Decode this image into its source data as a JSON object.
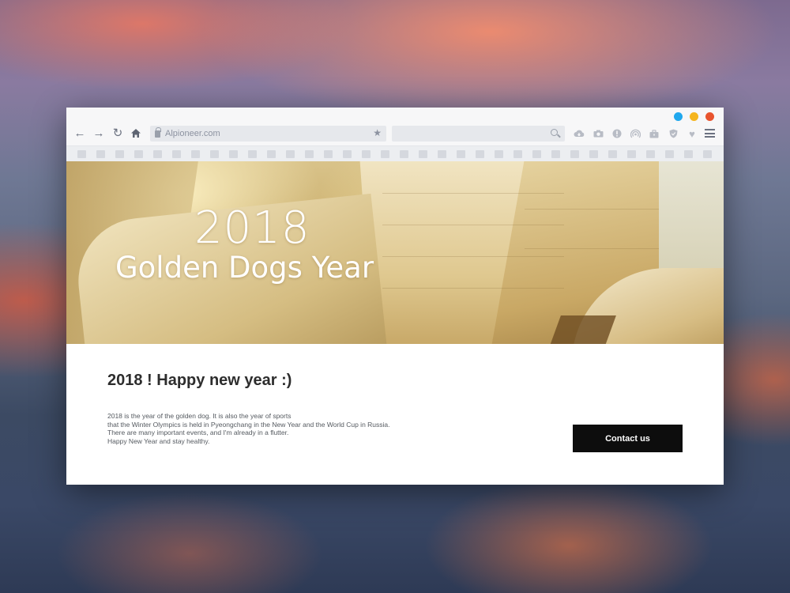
{
  "browser": {
    "window_controls": {
      "blue": "#20a8ee",
      "yellow": "#f5b51e",
      "red": "#e8542e"
    },
    "nav_icons": {
      "back": "←",
      "forward": "→",
      "reload": "↻",
      "home": "⌂"
    },
    "url": "Alpioneer.com",
    "bookmark_star": "★",
    "toolbar_icons": [
      "cloud-download-icon",
      "camera-icon",
      "info-icon",
      "broadcast-icon",
      "briefcase-icon",
      "shield-icon",
      "heart-icon"
    ],
    "toolbar_glyphs": {
      "heart": "♥",
      "info": "!"
    }
  },
  "hero": {
    "year": "2018",
    "subtitle": "Golden Dogs Year"
  },
  "content": {
    "heading": "2018 !  Happy new year :)",
    "body_lines": [
      "2018 is the year of the golden dog. It is also the year of sports",
      "that the Winter Olympics is held in Pyeongchang in the New Year and the World Cup in Russia.",
      "There are many important events,  and I'm already in a flutter.",
      "Happy New Year and stay healthy."
    ],
    "contact_button": "Contact us"
  }
}
